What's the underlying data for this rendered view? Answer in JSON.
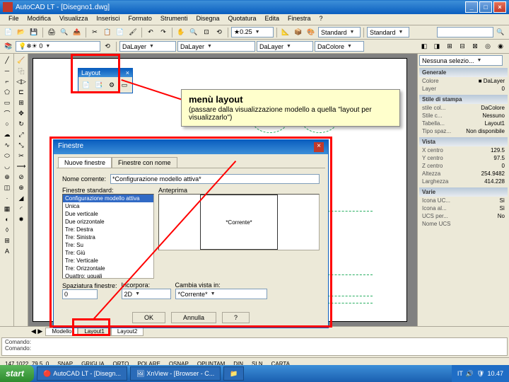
{
  "titlebar": {
    "title": "AutoCAD LT - [Disegno1.dwg]"
  },
  "menubar": [
    "File",
    "Modifica",
    "Visualizza",
    "Inserisci",
    "Formato",
    "Strumenti",
    "Disegna",
    "Quotatura",
    "Edita",
    "Finestra",
    "?"
  ],
  "toolbar2": {
    "layer_combo": "DaLayer",
    "layer2": "DaLayer",
    "ltype": "DaLayer",
    "lts": "DaColore"
  },
  "right": {
    "combo": "Nessuna selezio...",
    "groups": {
      "generale": {
        "title": "Generale",
        "rows": [
          {
            "k": "Colore",
            "v": "■ DaLayer"
          },
          {
            "k": "Layer",
            "v": "0"
          },
          {
            "k": "...",
            "v": ""
          }
        ]
      },
      "stile": {
        "title": "Stile di stampa",
        "rows": [
          {
            "k": "stile col...",
            "v": "DaColore"
          },
          {
            "k": "Stile c...",
            "v": "Nessuno"
          },
          {
            "k": "Tabella...",
            "v": "Layout1"
          },
          {
            "k": "Tipo spaz...",
            "v": "Non disponibile"
          }
        ]
      },
      "vista": {
        "title": "Vista",
        "rows": [
          {
            "k": "X centro",
            "v": "129.5"
          },
          {
            "k": "Y centro",
            "v": "97.5"
          },
          {
            "k": "Z centro",
            "v": "0"
          },
          {
            "k": "Altezza",
            "v": "254.9482"
          },
          {
            "k": "Larghezza",
            "v": "414.228"
          }
        ]
      },
      "varie": {
        "title": "Varie",
        "rows": [
          {
            "k": "Icona UC...",
            "v": "Sì"
          },
          {
            "k": "Icona al...",
            "v": "Sì"
          },
          {
            "k": "UCS per...",
            "v": "No"
          },
          {
            "k": "Nome UCS",
            "v": ""
          }
        ]
      }
    }
  },
  "tabs": {
    "model": "Modello",
    "layout1": "Layout1",
    "layout2": "Layout2"
  },
  "cmd": {
    "l1": "Comando:",
    "l2": "Comando:"
  },
  "status": {
    "coords": "147.1022, 79.5, 0",
    "buttons": [
      "SNAP",
      "GRIGLIA",
      "ORTO",
      "POLARE",
      "OSNAP",
      "OPUNTAM",
      "DIN",
      "SLN",
      "CARTA"
    ]
  },
  "taskbar": {
    "start": "start",
    "items": [
      "AutoCAD LT - [Disegn...",
      "XnView - [Browser - C...",
      ""
    ],
    "lang": "IT",
    "time": "10.47"
  },
  "layout_tb": {
    "title": "Layout"
  },
  "callout": {
    "title": "menù layout",
    "sub": "(passare dalla visualizzazione modello a quella \"layout per visualizzarlo\")"
  },
  "dialog": {
    "title": "Finestre",
    "tab1": "Nuove finestre",
    "tab2": "Finestre con nome",
    "name_label": "Nome corrente:",
    "name_val": "*Configurazione modello attiva*",
    "list_label": "Finestre standard:",
    "list": [
      "Configurazione modello attiva",
      "Unica",
      "Due verticale",
      "Due orizzontale",
      "Tre: Destra",
      "Tre: Sinistra",
      "Tre: Su",
      "Tre: Giù",
      "Tre: Verticale",
      "Tre: Orizzontale",
      "Quattro: uguali"
    ],
    "preview_label": "Anteprima",
    "preview_text": "*Corrente*",
    "applica_label": "Spaziatura finestre:",
    "applica_val": "0",
    "incorpor_label": "Incorpora:",
    "incorpor_val": "2D",
    "cambia_label": "Cambia vista in:",
    "cambia_val": "*Corrente*",
    "ok": "OK",
    "cancel": "Annulla",
    "help": "?"
  }
}
